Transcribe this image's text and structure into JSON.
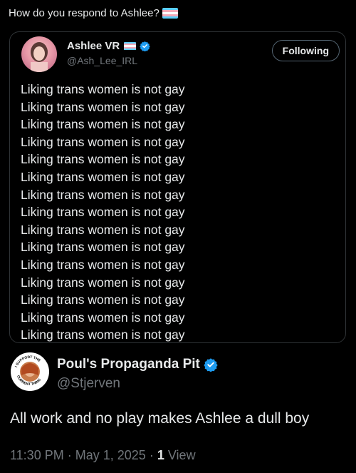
{
  "top_question": "How do you respond to Ashlee?",
  "quoted_post": {
    "author_name": "Ashlee VR",
    "handle": "@Ash_Lee_IRL",
    "follow_button_label": "Following",
    "lines": [
      "Liking trans women is not gay",
      "Liking trans women is not gay",
      "Liking trans women is not gay",
      "Liking trans women is not gay",
      "Liking trans women is not gay",
      "Liking trans women is not gay",
      "Liking trans women is not gay",
      "Liking trans women is not gay",
      "Liking trans women is not gay",
      "Liking trans women is not gay",
      "Liking trans women is not gay",
      "Liking trans women is not gay",
      "Liking trans women is not gay",
      "Liking trans women is not gay",
      "Liking trans women is not gay"
    ]
  },
  "reply_post": {
    "author_name": "Poul's Propaganda Pit",
    "handle": "@Stjerven",
    "avatar_badge_text_top": "I SUPPORT THE",
    "avatar_badge_text_bottom": "CURRENT THING",
    "body": "All work and no play makes Ashlee a dull boy",
    "time": "11:30 PM",
    "separator": "·",
    "date": "May 1, 2025",
    "views_count": "1",
    "views_label": "View"
  },
  "icons": {
    "trans_flag": "trans-flag-icon",
    "verified": "verified-badge-icon"
  },
  "colors": {
    "background": "#000000",
    "text_primary": "#e7e9ea",
    "text_secondary": "#71767b",
    "border": "#2f3336",
    "verified_blue": "#1d9bf0",
    "flag_blue": "#5bcefa",
    "flag_pink": "#f5a9b8",
    "flag_white": "#ffffff"
  }
}
